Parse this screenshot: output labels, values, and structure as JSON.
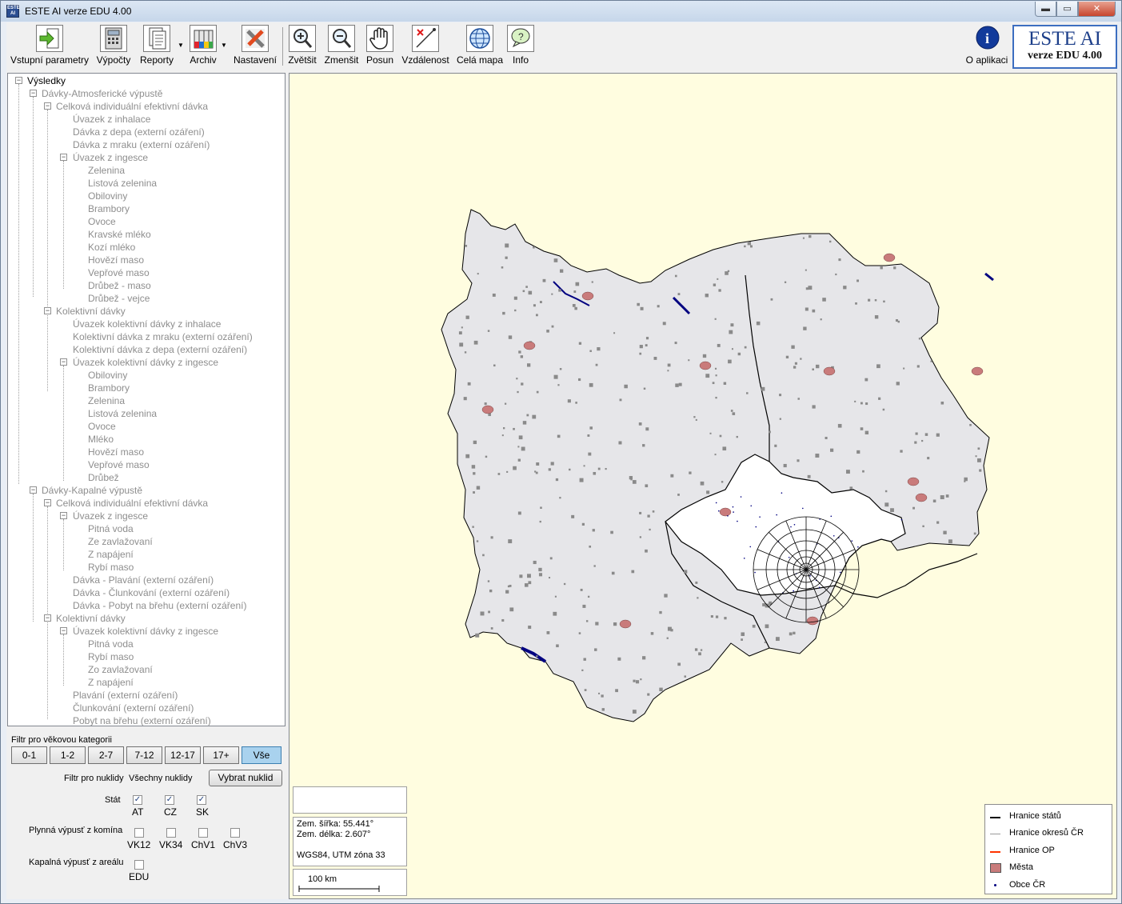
{
  "window": {
    "title": "ESTE AI verze EDU 4.00",
    "min_glyph": "▬",
    "max_glyph": "▭",
    "close_glyph": "✕"
  },
  "toolbar": {
    "input_params": "Vstupní parametry",
    "calculations": "Výpočty",
    "reports": "Reporty",
    "archive": "Archiv",
    "settings": "Nastavení",
    "zoom_in": "Zvětšit",
    "zoom_out": "Zmenšit",
    "pan": "Posun",
    "distance": "Vzdálenost",
    "full_map": "Celá mapa",
    "info": "Info",
    "about": "O aplikaci"
  },
  "brand": {
    "title": "ESTE AI",
    "subtitle": "verze EDU 4.00"
  },
  "tree": {
    "root": "Výsledky",
    "n1": "Dávky-Atmosferické výpustě",
    "n2": "Celková individuální efektivní dávka",
    "n3": "Úvazek z inhalace",
    "n4": "Dávka z depa (externí ozáření)",
    "n5": "Dávka z mraku (externí ozáření)",
    "n6": "Úvazek z ingesce",
    "n7": "Zelenina",
    "n8": "Listová zelenina",
    "n9": "Obiloviny",
    "n10": "Brambory",
    "n11": "Ovoce",
    "n12": "Kravské mléko",
    "n13": "Kozí mléko",
    "n14": "Hovězí maso",
    "n15": "Vepřové maso",
    "n16": "Drůbež - maso",
    "n17": "Drůbež - vejce",
    "n18": "Kolektivní dávky",
    "n19": "Úvazek kolektivní dávky z inhalace",
    "n20": "Kolektivní dávka z mraku (externí ozáření)",
    "n21": "Kolektivní dávka z depa (externí ozáření)",
    "n22": "Úvazek kolektivní dávky z ingesce",
    "n23": "Obiloviny",
    "n24": "Brambory",
    "n25": "Zelenina",
    "n26": "Listová zelenina",
    "n27": "Ovoce",
    "n28": "Mléko",
    "n29": "Hovězí maso",
    "n30": "Vepřové maso",
    "n31": "Drůbež",
    "n32": "Dávky-Kapalné výpustě",
    "n33": "Celková individuální efektivní dávka",
    "n34": "Úvazek z ingesce",
    "n35": "Pitná voda",
    "n36": "Ze zavlažovaní",
    "n37": "Z napájení",
    "n38": "Rybí maso",
    "n39": "Dávka - Plavání (externí ozáření)",
    "n40": "Dávka - Člunkování (externí ozáření)",
    "n41": "Dávka - Pobyt na břehu (externí ozáření)",
    "n42": "Kolektivní dávky",
    "n43": "Úvazek kolektivní dávky z ingesce",
    "n44": "Pitná voda",
    "n45": "Rybí maso",
    "n46": "Zo zavlažovaní",
    "n47": "Z napájení",
    "n48": "Plavání (externí ozáření)",
    "n49": "Člunkování (externí ozáření)",
    "n50": "Pobyt na břehu (externí ozáření)"
  },
  "filters": {
    "age_title": "Filtr pro věkovou kategorii",
    "ages": [
      "0-1",
      "1-2",
      "2-7",
      "7-12",
      "12-17",
      "17+",
      "Vše"
    ],
    "age_selected": "Vše",
    "nuclide_label": "Filtr pro nuklidy",
    "nuclide_value": "Všechny nuklidy",
    "pick_nuclide": "Vybrat nuklid",
    "state_label": "Stát",
    "states": [
      {
        "code": "AT",
        "checked": true
      },
      {
        "code": "CZ",
        "checked": true
      },
      {
        "code": "SK",
        "checked": true
      }
    ],
    "stack_label": "Plynná výpusť z komína",
    "stacks": [
      {
        "code": "VK12",
        "checked": false
      },
      {
        "code": "VK34",
        "checked": false
      },
      {
        "code": "ChV1",
        "checked": false
      },
      {
        "code": "ChV3",
        "checked": false
      }
    ],
    "liquid_label": "Kapalná výpusť z areálu",
    "liquid": {
      "code": "EDU",
      "checked": false
    },
    "check_glyph": "✓"
  },
  "map": {
    "lat": "Zem. šířka: 55.441°",
    "lon": "Zem. délka: 2.607°",
    "crs": "WGS84, UTM zóna 33",
    "scale": "100 km",
    "colors": {
      "background": "#fffde0",
      "land": "#e6e6e9",
      "cz": "#ffffff",
      "town": "#c97b7b",
      "water": "#000080",
      "border": "#000000"
    }
  },
  "legend": {
    "items": [
      {
        "label": "Hranice států",
        "color": "#000000"
      },
      {
        "label": "Hranice okresů ČR",
        "color": "#9a9a9a"
      },
      {
        "label": "Hranice OP",
        "color": "#ff3300"
      },
      {
        "label": "Města",
        "color": "#c97b7b"
      },
      {
        "label": "Obce ČR",
        "color": "#000080"
      }
    ]
  }
}
